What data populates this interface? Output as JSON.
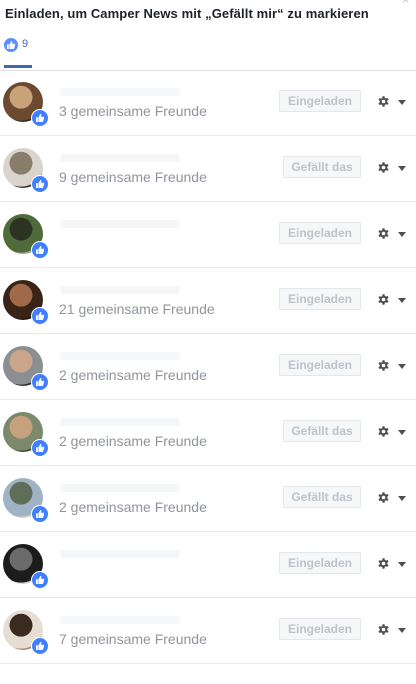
{
  "dialog": {
    "title": "Einladen, um Camper News mit „Gefällt mir“ zu markieren",
    "close_icon": "close-icon"
  },
  "tabs": [
    {
      "icon": "like-icon",
      "count": "9",
      "selected": true
    }
  ],
  "colors": {
    "accent": "#4267b2",
    "like_badge": "#4080ff",
    "muted_text": "#90949c",
    "disabled_button_text": "#bec3c9"
  },
  "people": [
    {
      "mutual_friends": "3 gemeinsame Freunde",
      "action_label": "Eingeladen",
      "action_state": "invited",
      "avatar_colors": [
        "#6b4a2f",
        "#c9a27a",
        "#3b2a1c"
      ]
    },
    {
      "mutual_friends": "9 gemeinsame Freunde",
      "action_label": "Gefällt das",
      "action_state": "liked",
      "avatar_colors": [
        "#d9d4cc",
        "#8a7d6c",
        "#3a342e"
      ]
    },
    {
      "mutual_friends": "",
      "action_label": "Eingeladen",
      "action_state": "invited",
      "avatar_colors": [
        "#4f6b3a",
        "#2c3322",
        "#9aa38a"
      ]
    },
    {
      "mutual_friends": "21 gemeinsame Freunde",
      "action_label": "Eingeladen",
      "action_state": "invited",
      "avatar_colors": [
        "#3a2418",
        "#a06a4a",
        "#1c120c"
      ]
    },
    {
      "mutual_friends": "2 gemeinsame Freunde",
      "action_label": "Eingeladen",
      "action_state": "invited",
      "avatar_colors": [
        "#8c8f92",
        "#c9a58a",
        "#2f3236"
      ]
    },
    {
      "mutual_friends": "2 gemeinsame Freunde",
      "action_label": "Gefällt das",
      "action_state": "liked",
      "avatar_colors": [
        "#7a8a6a",
        "#c7a07e",
        "#3e4a34"
      ]
    },
    {
      "mutual_friends": "2 gemeinsame Freunde",
      "action_label": "Gefällt das",
      "action_state": "liked",
      "avatar_colors": [
        "#9fb3c4",
        "#5f6e58",
        "#d8d2c2"
      ]
    },
    {
      "mutual_friends": "",
      "action_label": "Eingeladen",
      "action_state": "invited",
      "avatar_colors": [
        "#1c1c1c",
        "#6b6b6b",
        "#d0d0d0"
      ]
    },
    {
      "mutual_friends": "7 gemeinsame Freunde",
      "action_label": "Eingeladen",
      "action_state": "invited",
      "avatar_colors": [
        "#e6ddd3",
        "#3a2a20",
        "#b08b70"
      ]
    }
  ]
}
